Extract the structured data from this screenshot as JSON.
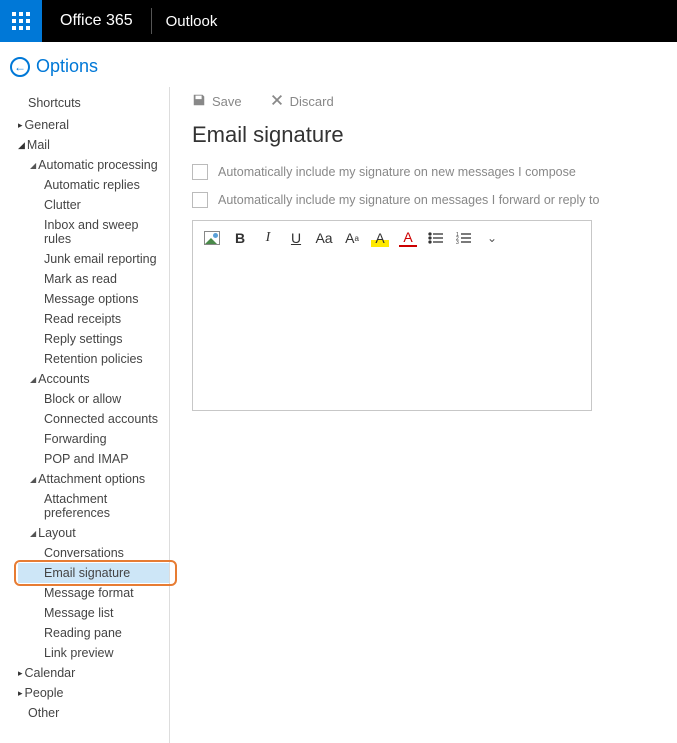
{
  "topbar": {
    "brand": "Office 365",
    "app": "Outlook"
  },
  "backrow": {
    "label": "Options"
  },
  "sidebar": {
    "shortcuts": "Shortcuts",
    "general": "General",
    "mail": "Mail",
    "autoProcessing": "Automatic processing",
    "autoReplies": "Automatic replies",
    "clutter": "Clutter",
    "inboxSweep": "Inbox and sweep rules",
    "junkReport": "Junk email reporting",
    "markRead": "Mark as read",
    "msgOptions": "Message options",
    "readReceipts": "Read receipts",
    "replySettings": "Reply settings",
    "retention": "Retention policies",
    "accounts": "Accounts",
    "blockAllow": "Block or allow",
    "connected": "Connected accounts",
    "forwarding": "Forwarding",
    "popimap": "POP and IMAP",
    "attachOpt": "Attachment options",
    "attachPref": "Attachment preferences",
    "layout": "Layout",
    "conversations": "Conversations",
    "emailSig": "Email signature",
    "msgFormat": "Message format",
    "msgList": "Message list",
    "readingPane": "Reading pane",
    "linkPreview": "Link preview",
    "calendar": "Calendar",
    "people": "People",
    "other": "Other"
  },
  "actions": {
    "save": "Save",
    "discard": "Discard"
  },
  "page": {
    "title": "Email signature",
    "chk1": "Automatically include my signature on new messages I compose",
    "chk2": "Automatically include my signature on messages I forward or reply to"
  },
  "toolbar": {
    "bold": "B",
    "italic": "I",
    "underline": "U",
    "fontsize": "Aa",
    "superscript": "A",
    "highlight": "A",
    "fontcolor": "A"
  }
}
